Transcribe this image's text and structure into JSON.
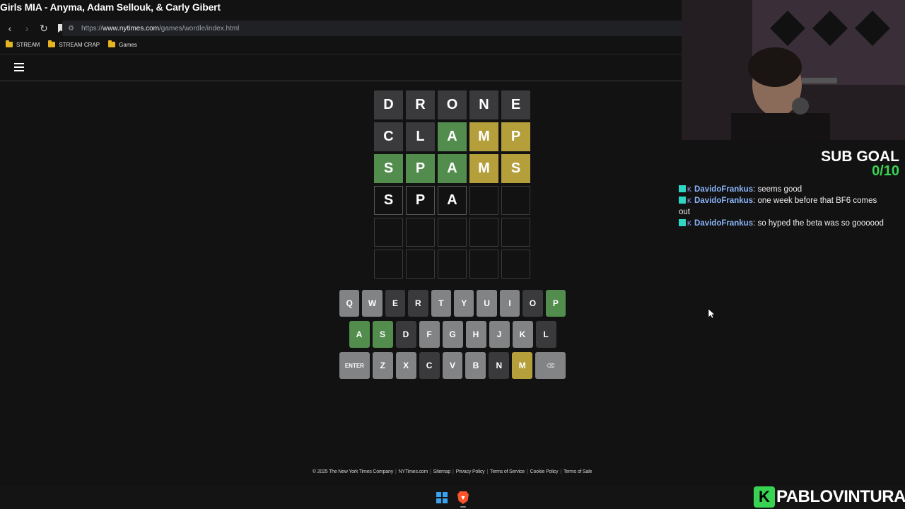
{
  "now_playing": "Girls MIA - Anyma, Adam Sellouk, & Carly Gibert",
  "browser": {
    "url_prefix": "https://",
    "url_host": "www.nytimes.com",
    "url_path": "/games/wordle/index.html",
    "bookmarks": [
      "STREAM",
      "STREAM CRAP",
      "Games"
    ]
  },
  "board": [
    [
      {
        "l": "D",
        "s": "absent"
      },
      {
        "l": "R",
        "s": "absent"
      },
      {
        "l": "O",
        "s": "absent"
      },
      {
        "l": "N",
        "s": "absent"
      },
      {
        "l": "E",
        "s": "absent"
      }
    ],
    [
      {
        "l": "C",
        "s": "absent"
      },
      {
        "l": "L",
        "s": "absent"
      },
      {
        "l": "A",
        "s": "correct"
      },
      {
        "l": "M",
        "s": "present"
      },
      {
        "l": "P",
        "s": "present"
      }
    ],
    [
      {
        "l": "S",
        "s": "correct"
      },
      {
        "l": "P",
        "s": "correct"
      },
      {
        "l": "A",
        "s": "correct"
      },
      {
        "l": "M",
        "s": "present"
      },
      {
        "l": "S",
        "s": "present"
      }
    ],
    [
      {
        "l": "S",
        "s": "tbd"
      },
      {
        "l": "P",
        "s": "tbd"
      },
      {
        "l": "A",
        "s": "tbd"
      },
      {
        "l": "",
        "s": "empty"
      },
      {
        "l": "",
        "s": "empty"
      }
    ],
    [
      {
        "l": "",
        "s": "empty"
      },
      {
        "l": "",
        "s": "empty"
      },
      {
        "l": "",
        "s": "empty"
      },
      {
        "l": "",
        "s": "empty"
      },
      {
        "l": "",
        "s": "empty"
      }
    ],
    [
      {
        "l": "",
        "s": "empty"
      },
      {
        "l": "",
        "s": "empty"
      },
      {
        "l": "",
        "s": "empty"
      },
      {
        "l": "",
        "s": "empty"
      },
      {
        "l": "",
        "s": "empty"
      }
    ]
  ],
  "keyboard": [
    [
      {
        "k": "Q",
        "s": ""
      },
      {
        "k": "W",
        "s": ""
      },
      {
        "k": "E",
        "s": "absent"
      },
      {
        "k": "R",
        "s": "absent"
      },
      {
        "k": "T",
        "s": ""
      },
      {
        "k": "Y",
        "s": ""
      },
      {
        "k": "U",
        "s": ""
      },
      {
        "k": "I",
        "s": ""
      },
      {
        "k": "O",
        "s": "absent"
      },
      {
        "k": "P",
        "s": "correct"
      }
    ],
    [
      {
        "k": "A",
        "s": "correct"
      },
      {
        "k": "S",
        "s": "correct"
      },
      {
        "k": "D",
        "s": "absent"
      },
      {
        "k": "F",
        "s": ""
      },
      {
        "k": "G",
        "s": ""
      },
      {
        "k": "H",
        "s": ""
      },
      {
        "k": "J",
        "s": ""
      },
      {
        "k": "K",
        "s": ""
      },
      {
        "k": "L",
        "s": "absent"
      }
    ],
    [
      {
        "k": "ENTER",
        "s": "",
        "wide": true
      },
      {
        "k": "Z",
        "s": ""
      },
      {
        "k": "X",
        "s": ""
      },
      {
        "k": "C",
        "s": "absent"
      },
      {
        "k": "V",
        "s": ""
      },
      {
        "k": "B",
        "s": ""
      },
      {
        "k": "N",
        "s": "absent"
      },
      {
        "k": "M",
        "s": "present"
      },
      {
        "k": "⌫",
        "s": "",
        "wide": true
      }
    ]
  ],
  "footer": [
    "© 2025 The New York Times Company",
    "NYTimes.com",
    "Sitemap",
    "Privacy Policy",
    "Terms of Service",
    "Cookie Policy",
    "Terms of Sale"
  ],
  "stream": {
    "sub_goal_label": "SUB GOAL",
    "sub_goal_value": "0/10",
    "chat": [
      {
        "user": "DavidoFrankus",
        "text": "seems good"
      },
      {
        "user": "DavidoFrankus",
        "text": "one week before that BF6 comes out"
      },
      {
        "user": "DavidoFrankus",
        "text": "so hyped the beta was so goooood"
      }
    ],
    "brand_letter": "K",
    "brand_name": "PABLOVINTURA"
  },
  "colors": {
    "correct": "#538d4e",
    "present": "#b59f3b",
    "absent": "#3a3a3c",
    "key_default": "#818384",
    "sub_goal_accent": "#39d353"
  }
}
